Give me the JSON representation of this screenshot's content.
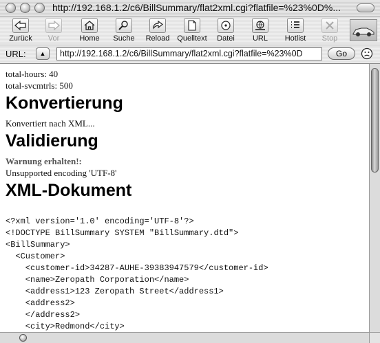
{
  "window": {
    "title": "http://192.168.1.2/c6/BillSummary/flat2xml.cgi?flatfile=%23%0D%..."
  },
  "toolbar": {
    "buttons": [
      {
        "label": "Zurück",
        "icon": "back-arrow-icon",
        "enabled": true
      },
      {
        "label": "Vor",
        "icon": "forward-arrow-icon",
        "enabled": false
      },
      {
        "label": "Home",
        "icon": "home-icon",
        "enabled": true
      },
      {
        "label": "Suche",
        "icon": "search-icon",
        "enabled": true
      },
      {
        "label": "Reload",
        "icon": "reload-icon",
        "enabled": true
      },
      {
        "label": "Quelltext",
        "icon": "source-icon",
        "enabled": true
      },
      {
        "label": "Datei",
        "icon": "disk-icon",
        "enabled": true
      },
      {
        "label": "URL",
        "icon": "url-icon",
        "enabled": true
      },
      {
        "label": "Hotlist",
        "icon": "hotlist-icon",
        "enabled": true
      },
      {
        "label": "Stop",
        "icon": "stop-icon",
        "enabled": false
      }
    ]
  },
  "urlbar": {
    "label": "URL:",
    "value": "http://192.168.1.2/c6/BillSummary/flat2xml.cgi?flatfile=%23%0D",
    "go_label": "Go"
  },
  "content": {
    "line1": "total-hours: 40",
    "line2": "total-svcmtrls: 500",
    "heading1": "Konvertierung",
    "text1": "Konvertiert nach XML...",
    "heading2": "Validierung",
    "warning": "Warnung erhalten!:",
    "text2": "Unsupported encoding 'UTF-8'",
    "heading3": "XML-Dokument",
    "xml_lines": [
      "<?xml version='1.0' encoding='UTF-8'?>",
      "<!DOCTYPE BillSummary SYSTEM \"BillSummary.dtd\">",
      "<BillSummary>",
      "  <Customer>",
      "    <customer-id>34287-AUHE-39383947579</customer-id>",
      "    <name>Zeropath Corporation</name>",
      "    <address1>123 Zeropath Street</address1>",
      "    <address2>",
      "    </address2>",
      "    <city>Redmond</city>"
    ]
  }
}
